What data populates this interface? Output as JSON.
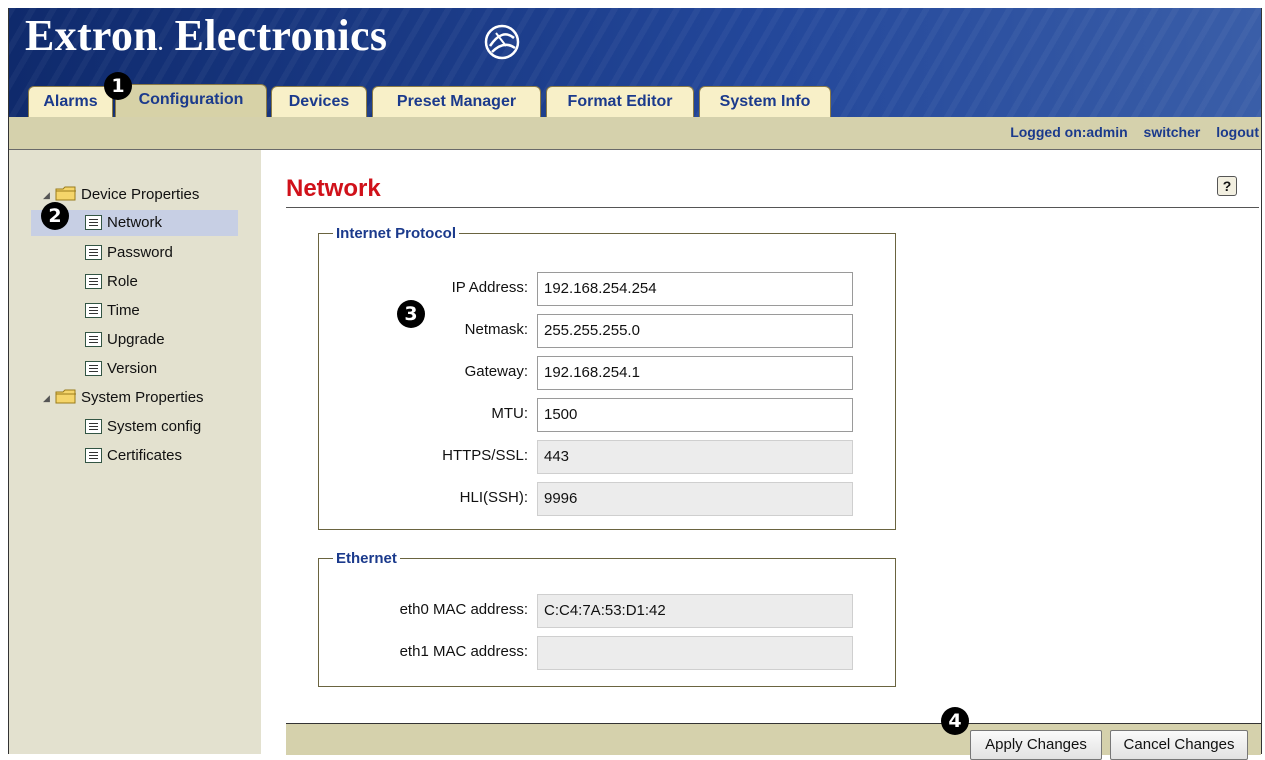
{
  "brand": {
    "name": "Extron",
    "dot": ".",
    "suffix": " Electronics"
  },
  "tabs": [
    {
      "label": "Alarms",
      "active": false
    },
    {
      "label": "Configuration",
      "active": true
    },
    {
      "label": "Devices",
      "active": false
    },
    {
      "label": "Preset Manager",
      "active": false
    },
    {
      "label": "Format Editor",
      "active": false
    },
    {
      "label": "System Info",
      "active": false
    }
  ],
  "userbar": {
    "logged_on": "Logged on:admin",
    "switcher": "switcher",
    "logout": "logout"
  },
  "sidebar": {
    "groups": [
      {
        "label": "Device Properties",
        "items": [
          "Network",
          "Password",
          "Role",
          "Time",
          "Upgrade",
          "Version"
        ]
      },
      {
        "label": "System Properties",
        "items": [
          "System config",
          "Certificates"
        ]
      }
    ],
    "selected": "Network"
  },
  "main": {
    "title": "Network",
    "help": "?",
    "internet_protocol": {
      "legend": "Internet Protocol",
      "fields": [
        {
          "label": "IP Address:",
          "value": "192.168.254.254",
          "editable": true
        },
        {
          "label": "Netmask:",
          "value": "255.255.255.0",
          "editable": true
        },
        {
          "label": "Gateway:",
          "value": "192.168.254.1",
          "editable": true
        },
        {
          "label": "MTU:",
          "value": "1500",
          "editable": true
        },
        {
          "label": "HTTPS/SSL:",
          "value": "443",
          "editable": false
        },
        {
          "label": "HLI(SSH):",
          "value": "9996",
          "editable": false
        }
      ]
    },
    "ethernet": {
      "legend": "Ethernet",
      "fields": [
        {
          "label": "eth0 MAC address:",
          "value": "C:C4:7A:53:D1:42",
          "editable": false
        },
        {
          "label": "eth1 MAC address:",
          "value": "",
          "editable": false
        }
      ]
    }
  },
  "buttons": {
    "apply": "Apply Changes",
    "cancel": "Cancel Changes"
  },
  "callouts": [
    "1",
    "2",
    "3",
    "4"
  ],
  "colors": {
    "header_blue": "#1b3a8c",
    "title_red": "#d0111a",
    "tab_bg": "#f8f0c8",
    "bar_tan": "#d5d1ac",
    "sidebar_bg": "#e3e1cf"
  }
}
